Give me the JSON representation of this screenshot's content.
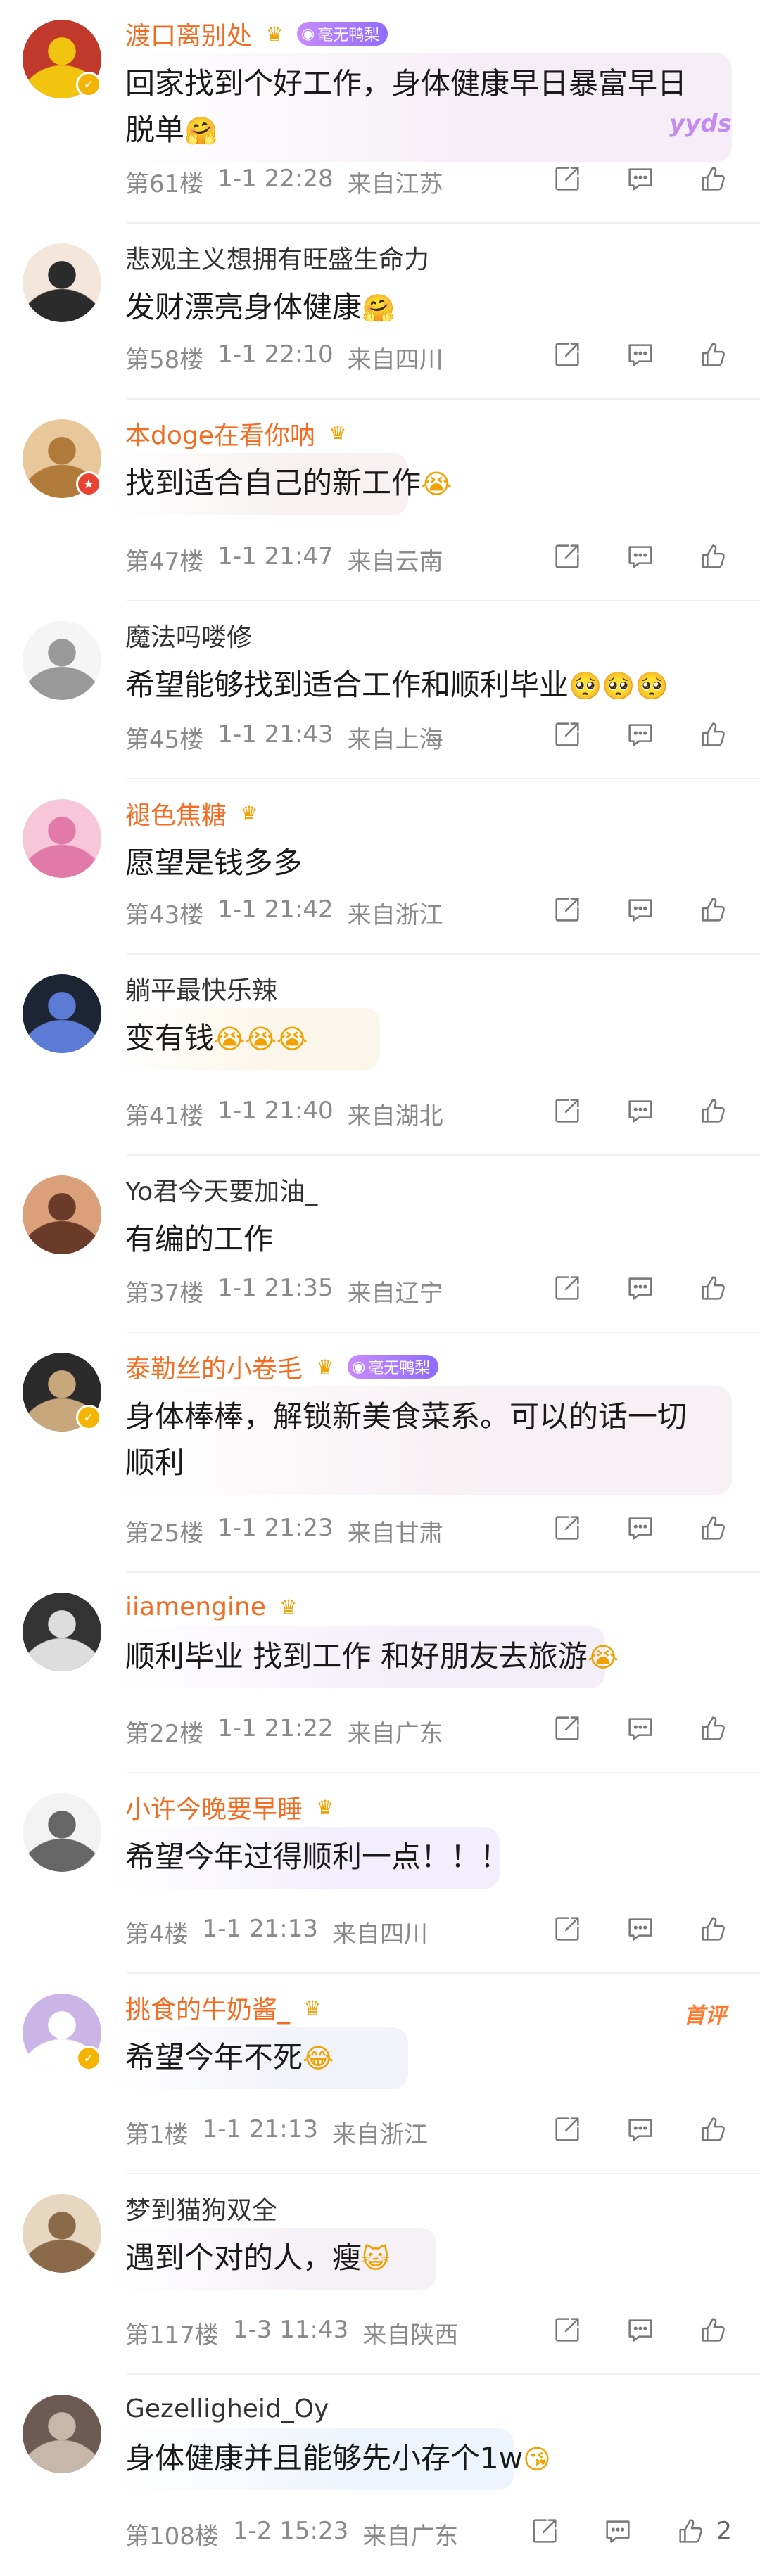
{
  "comments": [
    {
      "name": "渡口离别处",
      "vip": true,
      "crown": true,
      "fan_tag": "毫无鸭梨",
      "text1": "回家找到个好工作，身体健康早日暴富早日",
      "text2": "脱单",
      "text2_emoji": "🤗",
      "floor": "第61楼",
      "time": "1-1 22:28",
      "loc": "来自江苏",
      "deco": "yyds"
    },
    {
      "name": "悲观主义想拥有旺盛生命力",
      "vip": false,
      "text1": "发财漂亮身体健康",
      "text1_emoji": "🤗",
      "floor": "第58楼",
      "time": "1-1 22:10",
      "loc": "来自四川"
    },
    {
      "name": "本doge在看你呐",
      "vip": true,
      "crown": true,
      "text1": "找到适合自己的新工作",
      "text1_emoji": "😭",
      "floor": "第47楼",
      "time": "1-1 21:47",
      "loc": "来自云南"
    },
    {
      "name": "魔法吗喽修",
      "vip": false,
      "text1": "希望能够找到适合工作和顺利毕业",
      "text1_emoji": "🥺🥺🥺",
      "floor": "第45楼",
      "time": "1-1 21:43",
      "loc": "来自上海"
    },
    {
      "name": "褪色焦糖",
      "vip": true,
      "crown": true,
      "text1": "愿望是钱多多",
      "floor": "第43楼",
      "time": "1-1 21:42",
      "loc": "来自浙江"
    },
    {
      "name": "躺平最快乐辣",
      "vip": false,
      "text1": "变有钱",
      "text1_emoji": "😭😭😭",
      "floor": "第41楼",
      "time": "1-1 21:40",
      "loc": "来自湖北"
    },
    {
      "name": "Yo君今天要加油_",
      "vip": false,
      "text1": "有编的工作",
      "floor": "第37楼",
      "time": "1-1 21:35",
      "loc": "来自辽宁"
    },
    {
      "name": "泰勒丝的小卷毛",
      "vip": true,
      "crown": true,
      "fan_tag": "毫无鸭梨",
      "text1": "身体棒棒，解锁新美食菜系。可以的话一切",
      "text2": "顺利",
      "floor": "第25楼",
      "time": "1-1 21:23",
      "loc": "来自甘肃"
    },
    {
      "name": "iiamengine",
      "vip": true,
      "crown": true,
      "text1": "顺利毕业 找到工作 和好朋友去旅游",
      "text1_emoji": "😭",
      "floor": "第22楼",
      "time": "1-1 21:22",
      "loc": "来自广东"
    },
    {
      "name": "小许今晚要早睡",
      "vip": true,
      "crown": true,
      "text1": "希望今年过得顺利一点！！！",
      "floor": "第4楼",
      "time": "1-1 21:13",
      "loc": "来自四川"
    },
    {
      "name": "挑食的牛奶酱_",
      "vip": true,
      "crown": true,
      "top_tag": "首评",
      "text1": "希望今年不死",
      "text1_emoji": "😂",
      "floor": "第1楼",
      "time": "1-1 21:13",
      "loc": "来自浙江"
    },
    {
      "name": "梦到猫狗双全",
      "vip": false,
      "text1": "遇到个对的人，瘦",
      "text1_emoji": "😺",
      "floor": "第117楼",
      "time": "1-3 11:43",
      "loc": "来自陕西"
    },
    {
      "name": "Gezelligheid_Oy",
      "vip": false,
      "text1": "身体健康并且能够先小存个1w",
      "text1_emoji": "😘",
      "floor": "第108楼",
      "time": "1-2 15:23",
      "loc": "来自广东",
      "likes": "2"
    }
  ],
  "icons": {
    "share": "share-icon",
    "reply": "comment-icon",
    "like": "thumbs-up-icon",
    "crown": "crown-icon",
    "verified": "verified-badge-icon"
  },
  "colors": {
    "vip_name": "#f26c22",
    "meta": "#8a8a8a",
    "divider": "#efefef"
  }
}
